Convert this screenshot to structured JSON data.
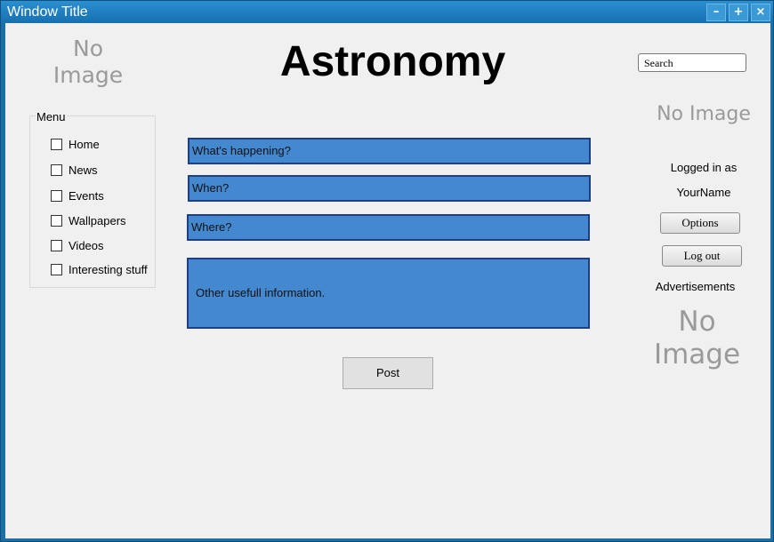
{
  "window": {
    "title": "Window Title",
    "minimize_glyph": "–",
    "maximize_glyph": "+",
    "close_glyph": "×"
  },
  "header": {
    "logo_placeholder": "No Image",
    "title": "Astronomy",
    "search_value": "Search"
  },
  "menu": {
    "legend": "Menu",
    "items": [
      {
        "label": "Home",
        "checked": false
      },
      {
        "label": "News",
        "checked": false
      },
      {
        "label": "Events",
        "checked": false
      },
      {
        "label": "Wallpapers",
        "checked": false
      },
      {
        "label": "Videos",
        "checked": false
      },
      {
        "label": "Interesting stuff",
        "checked": false
      }
    ]
  },
  "form": {
    "what": "What's happening?",
    "when": "When?",
    "where": "Where?",
    "other": "Other usefull information.",
    "post_label": "Post"
  },
  "user_panel": {
    "avatar_placeholder": "No Image",
    "logged_in_as": "Logged in as",
    "username": "YourName",
    "options_label": "Options",
    "logout_label": "Log out"
  },
  "ads": {
    "heading": "Advertisements",
    "placeholder": "No Image"
  },
  "colors": {
    "title_bar": "#1f7cbf",
    "field_fill": "#4488cf",
    "field_border": "#1e3e86",
    "client_bg": "#f0f0f0"
  }
}
